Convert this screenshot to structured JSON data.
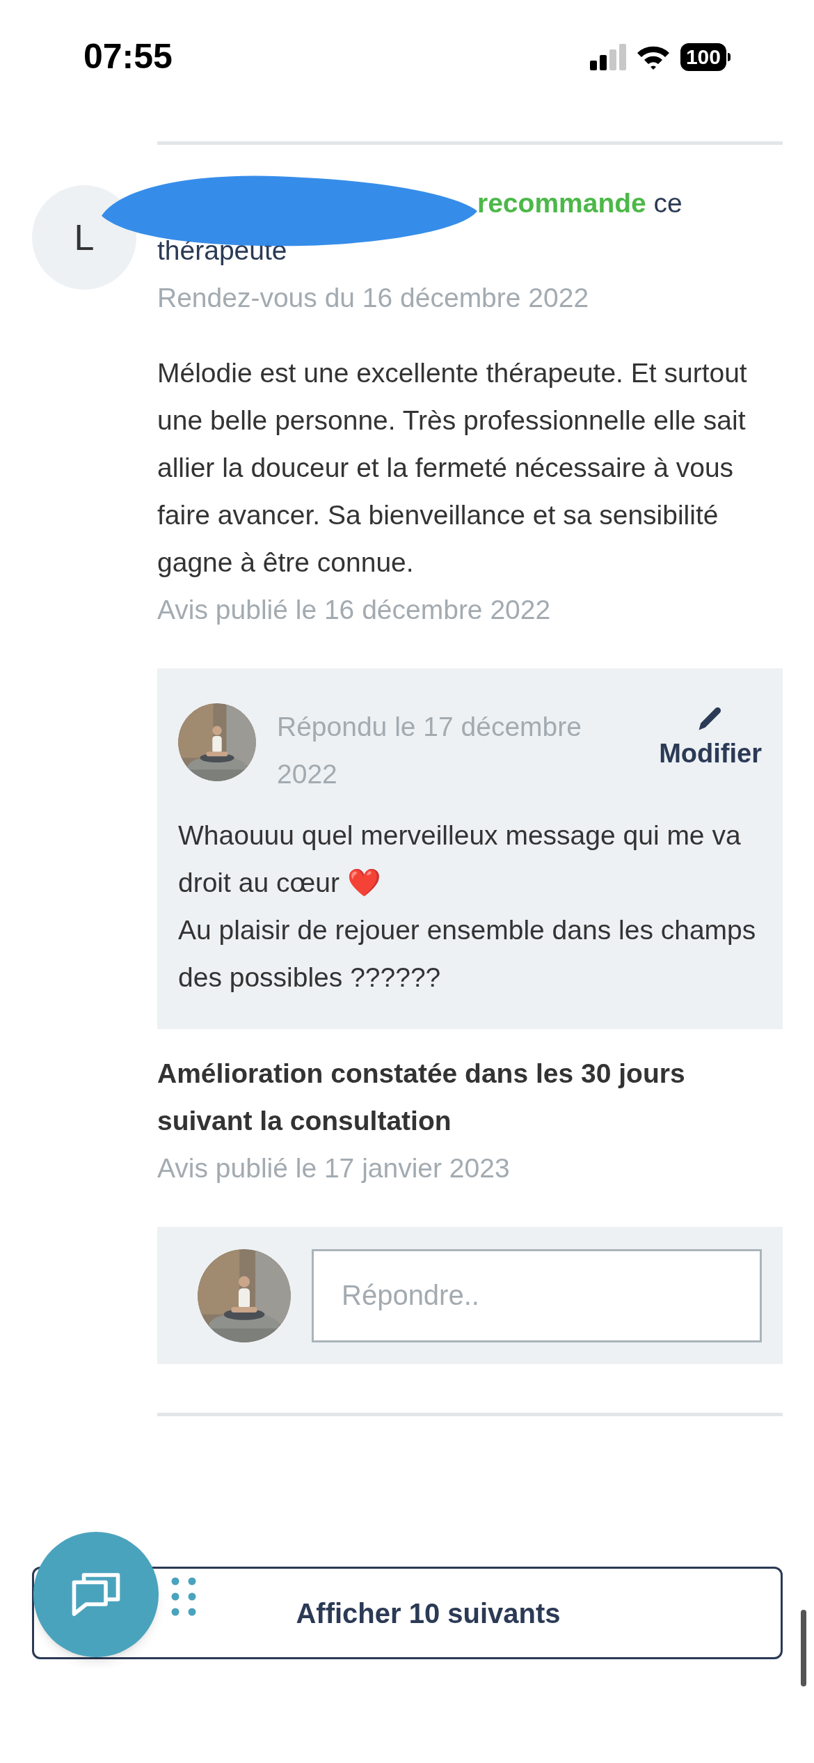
{
  "status_bar": {
    "time": "07:55",
    "battery": "100"
  },
  "review": {
    "avatar_letter": "L",
    "verb": "recommande",
    "rest": "ce thérapeute",
    "appointment": "Rendez-vous du 16 décembre 2022",
    "text": "Mélodie est une excellente thérapeute. Et surtout une belle personne. Très professionnelle elle sait allier la douceur et la fermeté nécessaire à vous faire avancer. Sa bienveillance et sa sensibilité gagne à être connue.",
    "published": "Avis publié le 16 décembre 2022"
  },
  "reply": {
    "date": "Répondu le 17 décembre 2022",
    "edit_label": "Modifier",
    "lines": [
      "Whaouuu quel merveilleux message qui me va droit au cœur ❤️",
      "Au plaisir de rejouer ensemble dans les champs des possibles ??????"
    ]
  },
  "improvement": {
    "text": "Amélioration constatée dans les 30 jours suivant la consultation",
    "published": "Avis publié le 17 janvier 2023"
  },
  "reply_field": {
    "placeholder": "Répondre.."
  },
  "more_button": {
    "label": "Afficher 10 suivants"
  }
}
